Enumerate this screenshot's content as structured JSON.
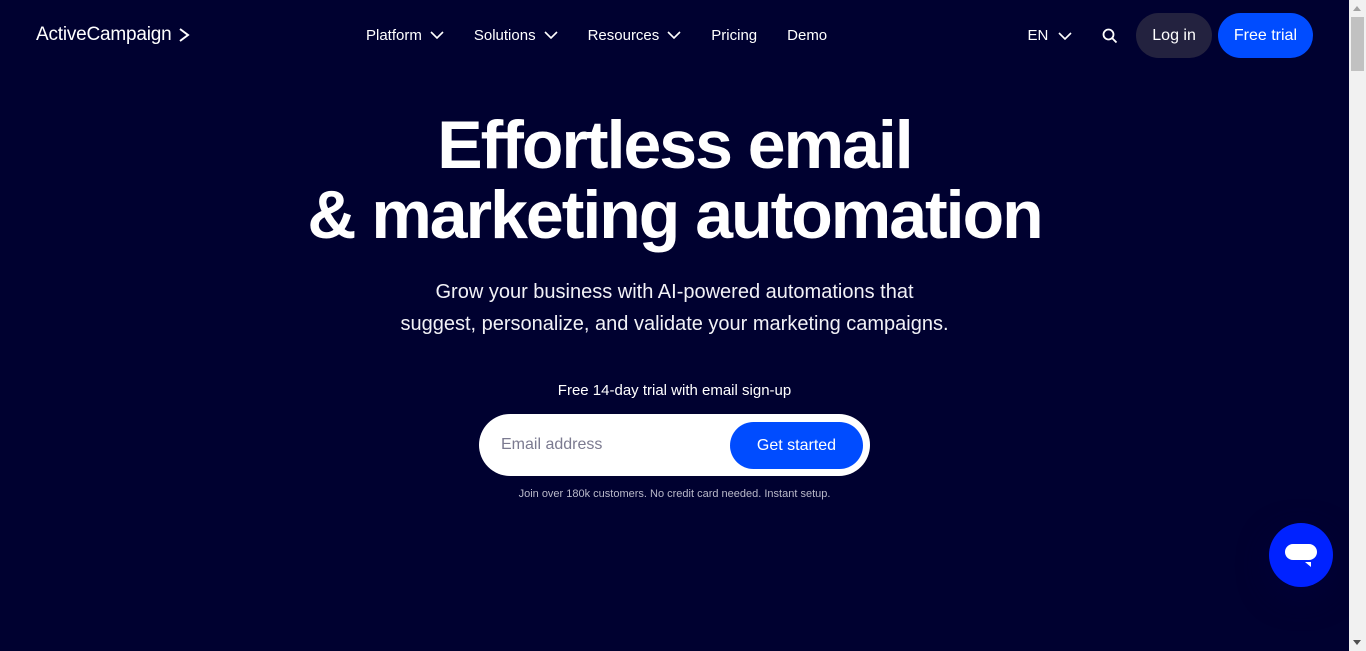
{
  "header": {
    "logo": "ActiveCampaign",
    "nav": [
      {
        "label": "Platform",
        "dropdown": true
      },
      {
        "label": "Solutions",
        "dropdown": true
      },
      {
        "label": "Resources",
        "dropdown": true
      },
      {
        "label": "Pricing",
        "dropdown": false
      },
      {
        "label": "Demo",
        "dropdown": false
      }
    ],
    "language": "EN",
    "login": "Log in",
    "free_trial": "Free trial"
  },
  "hero": {
    "title_line1": "Effortless email",
    "title_line2": "& marketing automation",
    "subtitle_line1": "Grow your business with AI-powered automations that",
    "subtitle_line2": "suggest, personalize, and validate your marketing campaigns.",
    "trial_note": "Free 14-day trial with email sign-up",
    "email_placeholder": "Email address",
    "cta": "Get started",
    "fine_print": "Join over 180k customers. No credit card needed. Instant setup."
  },
  "colors": {
    "background": "#000130",
    "accent": "#004cff",
    "chat": "#0022ff",
    "login_bg": "#23223f"
  },
  "icons": {
    "logo": "chevron-right-icon",
    "dropdown": "chevron-down-icon",
    "search": "search-icon",
    "chat": "chat-bubble-icon"
  }
}
